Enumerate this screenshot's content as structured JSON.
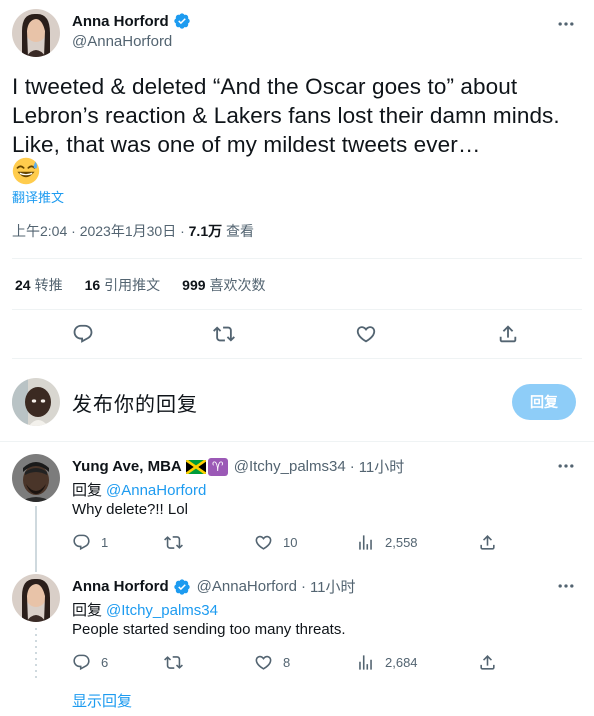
{
  "main_tweet": {
    "author_name": "Anna Horford",
    "author_handle": "@AnnaHorford",
    "text": "I tweeted & deleted “And the Oscar goes to” about Lebron’s reaction & Lakers fans lost their damn minds. Like, that was one of my mildest tweets ever…",
    "emoji": "sweat-smile-emoji",
    "translate_label": "翻译推文",
    "time": "上午2:04 · 2023年1月30日 · ",
    "views_count": "7.1万",
    "views_label": " 查看",
    "stats": {
      "retweets_count": "24",
      "retweets_label": "转推",
      "quotes_count": "16",
      "quotes_label": "引用推文",
      "likes_count": "999",
      "likes_label": "喜欢次数"
    }
  },
  "composer": {
    "placeholder": "发布你的回复",
    "button_label": "回复"
  },
  "replies": [
    {
      "author_name": "Yung Ave, MBA",
      "author_handle": "@Itchy_palms34",
      "time": "11小时",
      "reply_to_label": "回复",
      "reply_to_handle": "@AnnaHorford",
      "text": "Why delete?!! Lol",
      "replies": "1",
      "retweets": "",
      "likes": "10",
      "views": "2,558"
    },
    {
      "author_name": "Anna Horford",
      "author_handle": "@AnnaHorford",
      "time": "11小时",
      "reply_to_label": "回复",
      "reply_to_handle": "@Itchy_palms34",
      "text": "People started sending too many threats.",
      "replies": "6",
      "retweets": "",
      "likes": "8",
      "views": "2,684"
    }
  ],
  "show_replies_label": "显示回复",
  "colors": {
    "accent": "#1d9bf0",
    "text": "#0f1419",
    "muted": "#536471",
    "reply_button": "#8ecdf8"
  }
}
